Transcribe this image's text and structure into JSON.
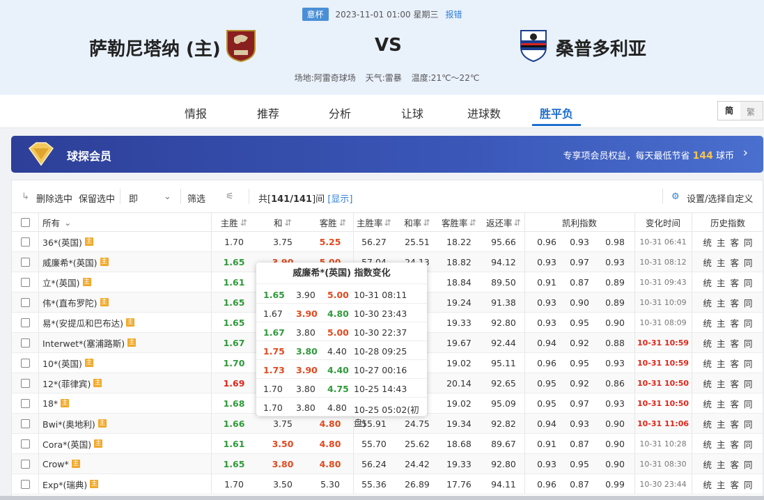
{
  "match": {
    "league": "意杯",
    "datetime": "2023-11-01 01:00 星期三",
    "report": "报错",
    "home": "萨勒尼塔纳 (主)",
    "vs": "VS",
    "away": "桑普多利亚",
    "venue": "场地:阿雷奇球场",
    "weather": "天气:雷暴",
    "temp": "温度:21℃～22℃"
  },
  "tabs": [
    "情报",
    "推荐",
    "分析",
    "让球",
    "进球数",
    "胜平负"
  ],
  "lang": {
    "simplified": "简",
    "traditional": "繁"
  },
  "vip": {
    "title": "球探会员",
    "promo_prefix": "专享项会员权益，每天最低节省",
    "promo_num": "144",
    "promo_suffix": "球币"
  },
  "toolbar": {
    "delete": "删除选中",
    "keep": "保留选中",
    "mode": "即",
    "filter": "筛选",
    "count_prefix": "共[",
    "count": "141/141",
    "count_suffix": "]间",
    "show": "[显示]",
    "settings": "设置/选择自定义"
  },
  "headers": {
    "company": "所有",
    "home": "主胜",
    "draw": "和",
    "away": "客胜",
    "home_rate": "主胜率",
    "draw_rate": "和率",
    "away_rate": "客胜率",
    "return_rate": "返还率",
    "kelly": "凯利指数",
    "change_time": "变化时间",
    "history": "历史指数"
  },
  "rows": [
    {
      "name": "36*(英国)",
      "h": "1.70",
      "d": "3.75",
      "a": "5.25",
      "hs": "",
      "ds": "",
      "as": "r",
      "hr": "56.27",
      "dr": "25.51",
      "ar": "18.22",
      "rr": "95.66",
      "k1": "0.96",
      "k2": "0.93",
      "k3": "0.98",
      "t": "10-31 06:41",
      "tr": false
    },
    {
      "name": "威廉希*(英国)",
      "h": "1.65",
      "d": "3.90",
      "a": "5.00",
      "hs": "g",
      "ds": "r",
      "as": "r",
      "hr": "57.04",
      "dr": "24.13",
      "ar": "18.82",
      "rr": "94.12",
      "k1": "0.93",
      "k2": "0.97",
      "k3": "0.93",
      "t": "10-31 08:12",
      "tr": false
    },
    {
      "name": "立*(英国)",
      "h": "1.61",
      "d": "",
      "a": "",
      "hs": "g",
      "ds": "",
      "as": "",
      "hr": "",
      "dr": "",
      "ar": "18.84",
      "rr": "89.50",
      "k1": "0.91",
      "k2": "0.87",
      "k3": "0.89",
      "t": "10-31 09:43",
      "tr": false
    },
    {
      "name": "伟*(直布罗陀)",
      "h": "1.65",
      "d": "",
      "a": "",
      "hs": "g",
      "ds": "",
      "as": "",
      "hr": "",
      "dr": "",
      "ar": "19.24",
      "rr": "91.38",
      "k1": "0.93",
      "k2": "0.90",
      "k3": "0.89",
      "t": "10-31 10:09",
      "tr": false
    },
    {
      "name": "易*(安提瓜和巴布达)",
      "h": "1.65",
      "d": "",
      "a": "",
      "hs": "g",
      "ds": "",
      "as": "",
      "hr": "",
      "dr": "",
      "ar": "19.33",
      "rr": "92.80",
      "k1": "0.93",
      "k2": "0.95",
      "k3": "0.90",
      "t": "10-31 08:09",
      "tr": false
    },
    {
      "name": "Interwet*(塞浦路斯)",
      "h": "1.67",
      "d": "",
      "a": "",
      "hs": "g",
      "ds": "",
      "as": "",
      "hr": "",
      "dr": "",
      "ar": "19.67",
      "rr": "92.44",
      "k1": "0.94",
      "k2": "0.92",
      "k3": "0.88",
      "t": "10-31 10:59",
      "tr": true
    },
    {
      "name": "10*(英国)",
      "h": "1.70",
      "d": "",
      "a": "",
      "hs": "g",
      "ds": "",
      "as": "",
      "hr": "",
      "dr": "",
      "ar": "19.02",
      "rr": "95.11",
      "k1": "0.96",
      "k2": "0.95",
      "k3": "0.93",
      "t": "10-31 10:59",
      "tr": true
    },
    {
      "name": "12*(菲律宾)",
      "h": "1.69",
      "d": "",
      "a": "",
      "hs": "dr",
      "ds": "",
      "as": "",
      "hr": "",
      "dr": "",
      "ar": "20.14",
      "rr": "92.65",
      "k1": "0.95",
      "k2": "0.92",
      "k3": "0.86",
      "t": "10-31 10:50",
      "tr": true
    },
    {
      "name": "18*",
      "h": "1.68",
      "d": "",
      "a": "",
      "hs": "g",
      "ds": "",
      "as": "",
      "hr": "",
      "dr": "",
      "ar": "19.02",
      "rr": "95.09",
      "k1": "0.95",
      "k2": "0.97",
      "k3": "0.93",
      "t": "10-31 10:50",
      "tr": true
    },
    {
      "name": "Bwi*(奥地利)",
      "h": "1.66",
      "d": "3.75",
      "a": "4.80",
      "hs": "g",
      "ds": "",
      "as": "r",
      "hr": "55.91",
      "dr": "24.75",
      "ar": "19.34",
      "rr": "92.82",
      "k1": "0.94",
      "k2": "0.93",
      "k3": "0.90",
      "t": "10-31 11:06",
      "tr": true
    },
    {
      "name": "Cora*(英国)",
      "h": "1.61",
      "d": "3.50",
      "a": "4.80",
      "hs": "g",
      "ds": "r",
      "as": "r",
      "hr": "55.70",
      "dr": "25.62",
      "ar": "18.68",
      "rr": "89.67",
      "k1": "0.91",
      "k2": "0.87",
      "k3": "0.90",
      "t": "10-31 10:28",
      "tr": false
    },
    {
      "name": "Crow*",
      "h": "1.65",
      "d": "3.80",
      "a": "4.80",
      "hs": "g",
      "ds": "r",
      "as": "r",
      "hr": "56.24",
      "dr": "24.42",
      "ar": "19.33",
      "rr": "92.80",
      "k1": "0.93",
      "k2": "0.95",
      "k3": "0.90",
      "t": "10-31 08:30",
      "tr": false
    },
    {
      "name": "Exp*(瑞典)",
      "h": "1.70",
      "d": "3.50",
      "a": "5.30",
      "hs": "",
      "ds": "",
      "as": "",
      "hr": "55.36",
      "dr": "26.89",
      "ar": "17.76",
      "rr": "94.11",
      "k1": "0.96",
      "k2": "0.87",
      "k3": "0.99",
      "t": "10-30 23:44",
      "tr": false
    }
  ],
  "history_links": "统 主 客 同",
  "host_tag": "主",
  "popup": {
    "title": "威廉希*(英国) 指数变化",
    "rows": [
      {
        "h": "1.65",
        "d": "3.90",
        "a": "5.00",
        "t": "10-31 08:11",
        "hs": "g",
        "ds": "",
        "as": "r"
      },
      {
        "h": "1.67",
        "d": "3.90",
        "a": "4.80",
        "t": "10-30 23:43",
        "hs": "",
        "ds": "r",
        "as": "g"
      },
      {
        "h": "1.67",
        "d": "3.80",
        "a": "5.00",
        "t": "10-30 22:37",
        "hs": "g",
        "ds": "",
        "as": "r"
      },
      {
        "h": "1.75",
        "d": "3.80",
        "a": "4.40",
        "t": "10-28 09:25",
        "hs": "r",
        "ds": "g",
        "as": ""
      },
      {
        "h": "1.73",
        "d": "3.90",
        "a": "4.40",
        "t": "10-27 00:16",
        "hs": "r",
        "ds": "r",
        "as": "g"
      },
      {
        "h": "1.70",
        "d": "3.80",
        "a": "4.75",
        "t": "10-25 14:43",
        "hs": "",
        "ds": "",
        "as": "g"
      },
      {
        "h": "1.70",
        "d": "3.80",
        "a": "4.80",
        "t": "10-25 05:02(初盘)",
        "hs": "",
        "ds": "",
        "as": ""
      }
    ]
  }
}
